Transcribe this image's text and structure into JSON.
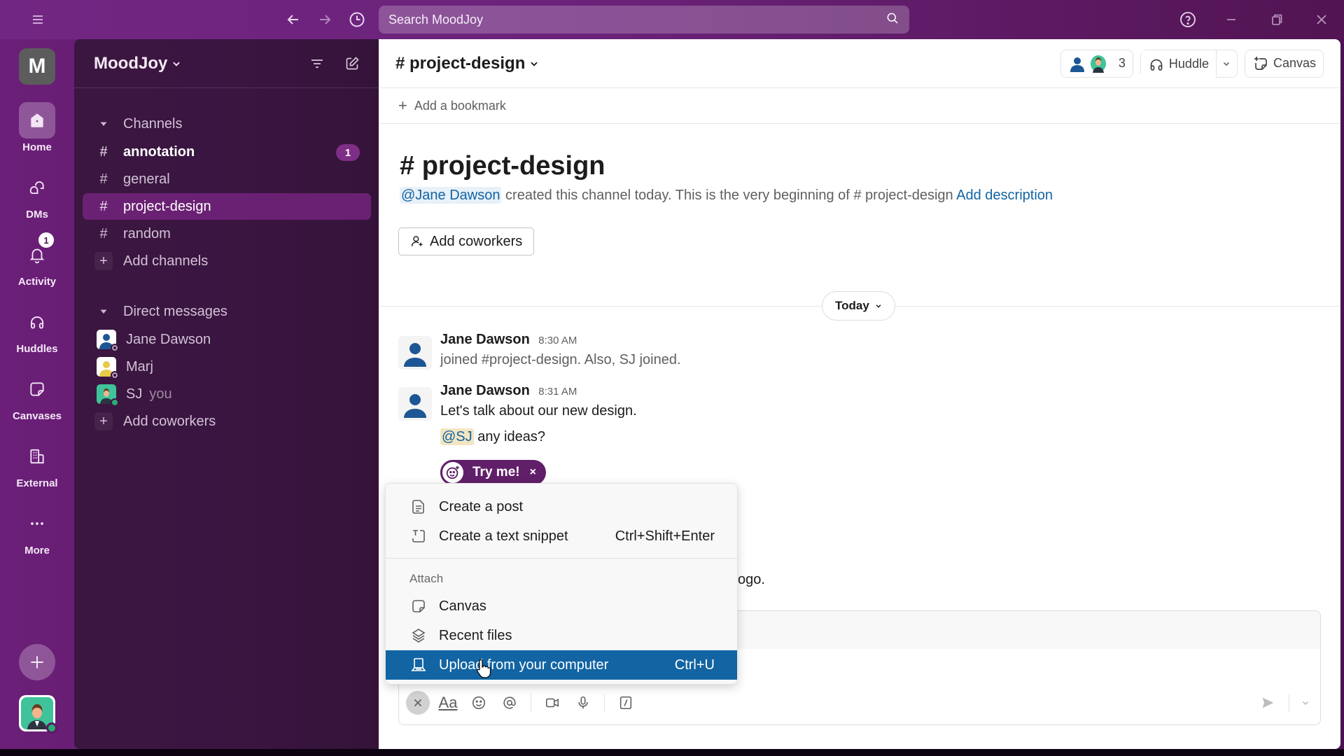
{
  "app": {
    "workspace_initial": "M",
    "workspace_name": "MoodJoy"
  },
  "titlebar": {
    "search_placeholder": "Search MoodJoy",
    "icons": [
      "menu-icon",
      "back-arrow-icon",
      "forward-arrow-icon",
      "history-icon",
      "search-icon",
      "help-icon",
      "minimize-icon",
      "restore-icon",
      "close-icon"
    ]
  },
  "rail": {
    "items": [
      {
        "label": "Home",
        "icon": "home-icon",
        "active": true
      },
      {
        "label": "DMs",
        "icon": "dms-icon"
      },
      {
        "label": "Activity",
        "icon": "bell-icon",
        "badge": "1"
      },
      {
        "label": "Huddles",
        "icon": "headphones-icon"
      },
      {
        "label": "Canvases",
        "icon": "canvas-icon"
      },
      {
        "label": "External",
        "icon": "building-icon"
      },
      {
        "label": "More",
        "icon": "more-dots-icon"
      }
    ]
  },
  "sidebar": {
    "channels_header": "Channels",
    "channels": [
      {
        "name": "annotation",
        "bold": true,
        "badge": "1"
      },
      {
        "name": "general"
      },
      {
        "name": "project-design",
        "active": true
      },
      {
        "name": "random"
      }
    ],
    "add_channels": "Add channels",
    "dm_header": "Direct messages",
    "dms": [
      {
        "name": "Jane Dawson",
        "status": "away"
      },
      {
        "name": "Marj",
        "status": "away"
      },
      {
        "name": "SJ",
        "suffix": "you",
        "status": "online"
      }
    ],
    "add_coworkers": "Add coworkers"
  },
  "channel": {
    "header_title": "# project-design",
    "member_count": "3",
    "huddle_label": "Huddle",
    "canvas_label": "Canvas",
    "bookmark_label": "Add a bookmark",
    "intro_title": "# project-design",
    "intro_mention": "@Jane Dawson",
    "intro_text": " created this channel today. This is the very beginning of # project-design ",
    "intro_link": "Add description",
    "add_coworkers_button": "Add coworkers",
    "day_divider": "Today"
  },
  "messages": [
    {
      "author": "Jane Dawson",
      "time": "8:30 AM",
      "text": "joined #project-design. Also, SJ joined."
    },
    {
      "author": "Jane Dawson",
      "time": "8:31 AM",
      "text": "Let's talk about our new design.",
      "mention": "@SJ",
      "followup": " any ideas?"
    }
  ],
  "tryme": {
    "label": "Try me!",
    "close": "×"
  },
  "partial_message_fragment": "ogo.",
  "menu": {
    "items": [
      {
        "label": "Create a post",
        "icon": "document-icon"
      },
      {
        "label": "Create a text snippet",
        "icon": "snippet-icon",
        "shortcut": "Ctrl+Shift+Enter"
      }
    ],
    "attach_label": "Attach",
    "attach_items": [
      {
        "label": "Canvas",
        "icon": "canvas-icon"
      },
      {
        "label": "Recent files",
        "icon": "layers-icon"
      },
      {
        "label": "Upload from your computer",
        "icon": "laptop-icon",
        "shortcut": "Ctrl+U",
        "highlighted": true
      }
    ]
  },
  "composer": {
    "toolbar": [
      "close-plus-button",
      "formatting-button",
      "emoji-button",
      "mention-button",
      "video-clip-button",
      "audio-clip-button",
      "slash-command-button",
      "send-button",
      "send-options-button"
    ],
    "formatting_label": "Aa"
  },
  "colors": {
    "brand_purple": "#611f69",
    "sidebar_bg": "#3a1541",
    "active_channel": "#6b2173",
    "highlight_blue": "#1264a3",
    "online_green": "#2bac76"
  }
}
